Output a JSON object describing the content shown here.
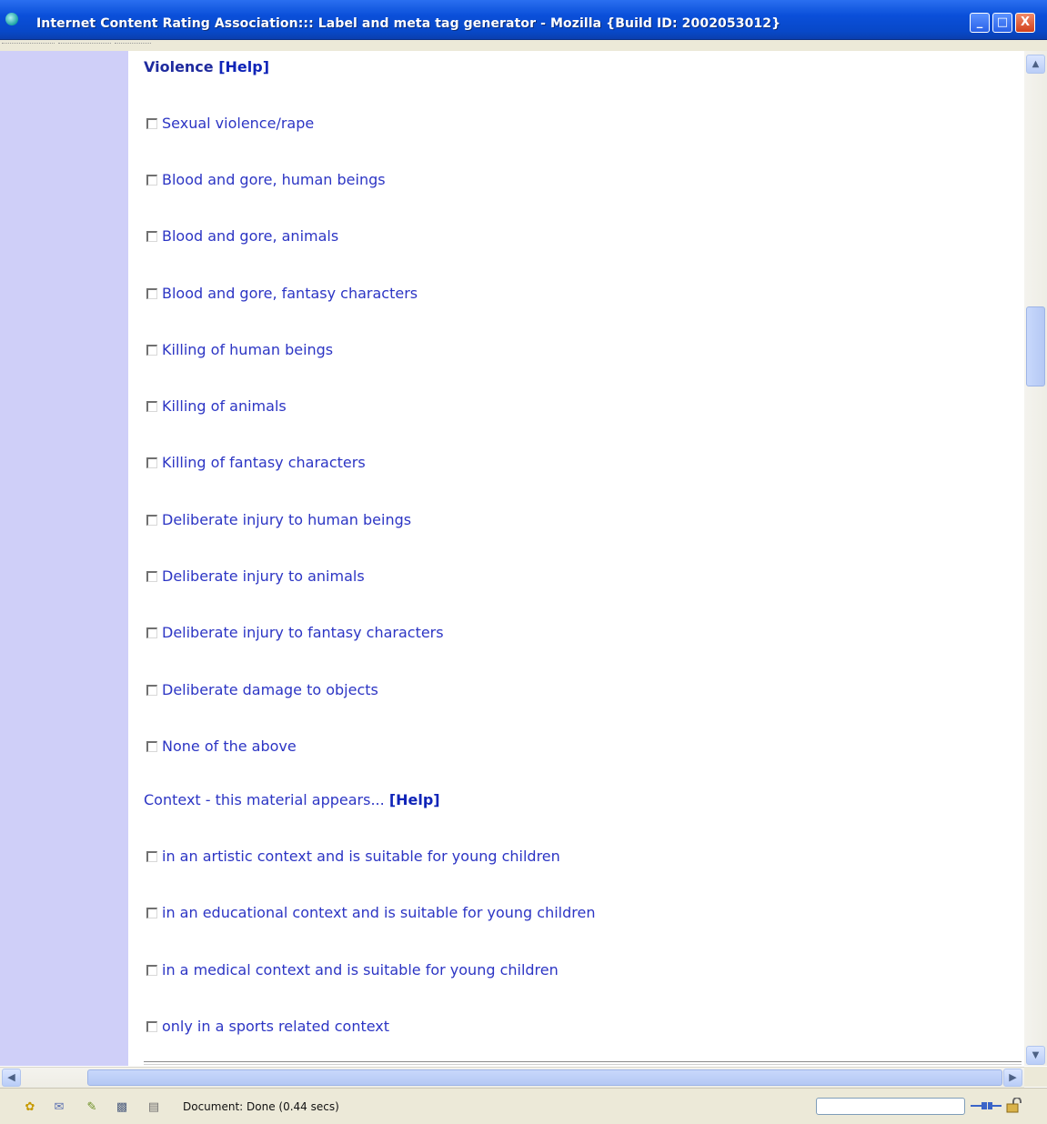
{
  "window": {
    "title": "Internet Content Rating Association::: Label and meta tag generator - Mozilla {Build ID: 2002053012}",
    "controls": {
      "minimize": "_",
      "maximize": "□",
      "close": "X"
    }
  },
  "violence": {
    "heading": "Violence",
    "help": "[Help]",
    "options": [
      "Sexual violence/rape",
      "Blood and gore, human beings",
      "Blood and gore, animals",
      "Blood and gore, fantasy characters",
      "Killing of human beings",
      "Killing of animals",
      "Killing of fantasy characters",
      "Deliberate injury to human beings",
      "Deliberate injury to animals",
      "Deliberate injury to fantasy characters",
      "Deliberate damage to objects",
      "None of the above"
    ]
  },
  "context": {
    "heading": "Context - this material appears...",
    "help": "[Help]",
    "options": [
      "in an artistic context and is suitable for young children",
      "in an educational context and is suitable for young children",
      "in a medical context and is suitable for young children",
      "only in a sports related context"
    ]
  },
  "statusbar": {
    "icons": [
      "navigator-icon",
      "mail-icon",
      "composer-icon",
      "address-book-icon",
      "chat-icon"
    ],
    "text": "Document: Done (0.44 secs)"
  }
}
